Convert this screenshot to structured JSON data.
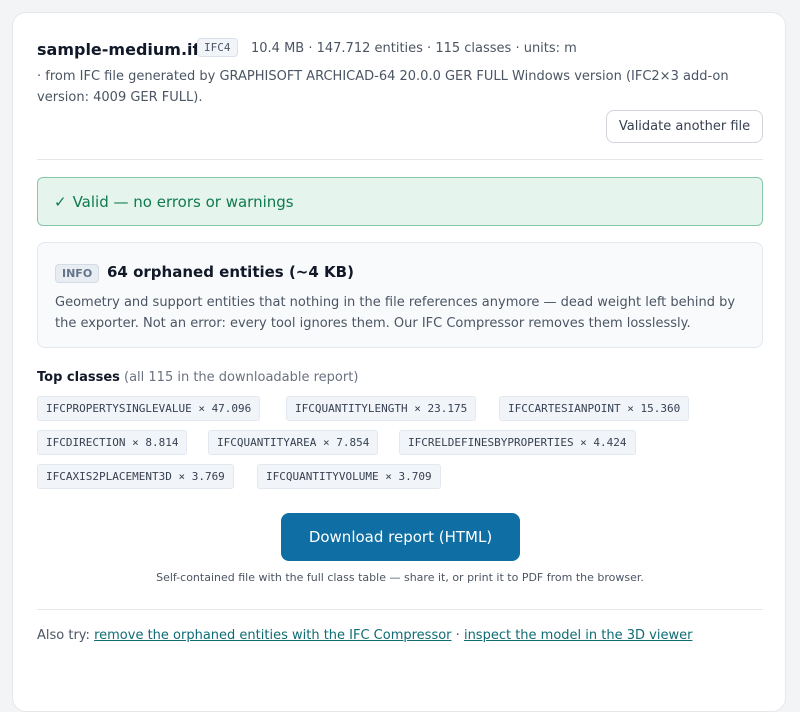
{
  "file": {
    "name": "sample-medium.ifc",
    "schema": "IFC4",
    "stats": "10.4 MB · 147.712 entities · 115 classes · units: m",
    "origin": "· from IFC file generated by GRAPHISOFT ARCHICAD-64 20.0.0 GER FULL Windows version (IFC2×3 add-on version: 4009 GER FULL)."
  },
  "validate_button": "Validate another file",
  "valid": {
    "check_icon": "✓",
    "message": "Valid — no errors or warnings"
  },
  "info": {
    "badge": "INFO",
    "title": "64 orphaned entities (~4 KB)",
    "description": "Geometry and support entities that nothing in the file references anymore — dead weight left behind by the exporter. Not an error: every tool ignores them. Our IFC Compressor removes them losslessly."
  },
  "top_classes": {
    "heading": "Top classes",
    "subheading": "(all 115 in the downloadable report)",
    "chips": [
      "IFCPROPERTYSINGLEVALUE × 47.096",
      "IFCQUANTITYLENGTH × 23.175",
      "IFCCARTESIANPOINT × 15.360",
      "IFCDIRECTION × 8.814",
      "IFCQUANTITYAREA × 7.854",
      "IFCRELDEFINESBYPROPERTIES × 4.424",
      "IFCAXIS2PLACEMENT3D × 3.769",
      "IFCQUANTITYVOLUME × 3.709"
    ]
  },
  "download": {
    "label": "Download report (HTML)",
    "note": "Self-contained file with the full class table — share it, or print it to PDF from the browser."
  },
  "also_try": {
    "prefix": "Also try:",
    "link1": "remove the orphaned entities with the IFC Compressor",
    "separator": "·",
    "link2": "inspect the model in the 3D viewer"
  },
  "colors": {
    "accent": "#0f6ea3",
    "success_bg": "#e6f4ee",
    "success_text": "#0f7a4f",
    "link": "#0f6c73"
  }
}
